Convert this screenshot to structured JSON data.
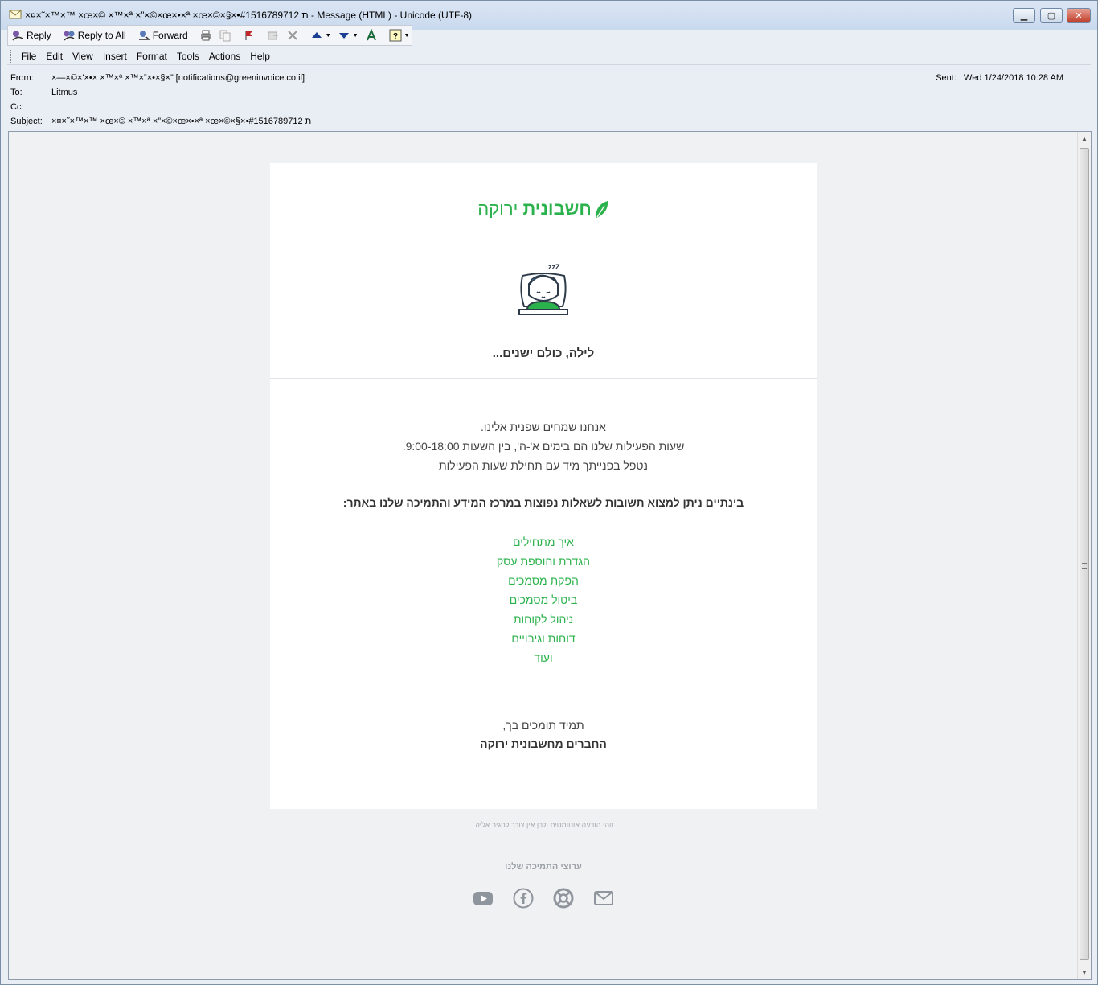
{
  "window": {
    "title": "×¤×˜×™×™ ×œ×© ×™×ª ×”×©×œ×•×ª ×œ×©×§×•ת #1516789712 - Message (HTML)  - Unicode (UTF-8)"
  },
  "toolbar": {
    "reply_label": "Reply",
    "reply_all_label": "Reply to All",
    "forward_label": "Forward"
  },
  "menu": {
    "file": "File",
    "edit": "Edit",
    "view": "View",
    "insert": "Insert",
    "format": "Format",
    "tools": "Tools",
    "actions": "Actions",
    "help": "Help"
  },
  "header": {
    "from_label": "From:",
    "from_value": "×—×©×'×•× ×™×ª ×™×¨×•×§×” [notifications@greeninvoice.co.il]",
    "to_label": "To:",
    "to_value": "Litmus",
    "cc_label": "Cc:",
    "cc_value": "",
    "subject_label": "Subject:",
    "subject_value": "×¤×˜×™×™ ×œ×© ×™×ª ×”×©×œ×•×ª ×œ×©×§×•ת #1516789712",
    "sent_label": "Sent:",
    "sent_value": "Wed 1/24/2018 10:28 AM"
  },
  "email": {
    "logo_bold": "חשבונית",
    "logo_light": "ירוקה",
    "heading": "לילה, כולם ישנים...",
    "line1": "אנחנו שמחים שפנית אלינו.",
    "line2": "שעות הפעילות שלנו הם בימים א'-ה', בין השעות 9:00-18:00.",
    "line3": "נטפל בפנייתך מיד עם תחילת שעות הפעילות",
    "faq_intro": "בינתיים ניתן למצוא תשובות לשאלות נפוצות במרכז המידע והתמיכה שלנו באתר:",
    "links": [
      "איך מתחילים",
      "הגדרת והוספת עסק",
      "הפקת מסמכים",
      "ביטול מסמכים",
      "ניהול לקוחות",
      "דוחות וגיבויים",
      "ועוד"
    ],
    "signoff": "תמיד תומכים בך,",
    "signature": "החברים מחשבונית ירוקה"
  },
  "footer": {
    "note": "זוהי הודעה אוטומטית ולכן אין צורך להגיב אליה.",
    "channels_title": "ערוצי התמיכה שלנו"
  },
  "colors": {
    "brand_green": "#2bb24c",
    "social_gray": "#8f959c"
  }
}
